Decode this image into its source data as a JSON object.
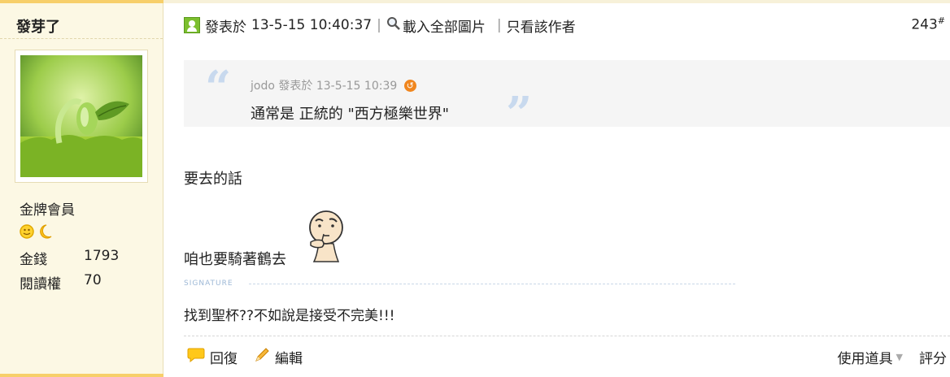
{
  "sidebar": {
    "username": "發芽了",
    "rank": "金牌會員",
    "stats": [
      {
        "label": "金錢",
        "value": "1793"
      },
      {
        "label": "閱讀權",
        "value": "70"
      }
    ]
  },
  "post": {
    "posted_label": "發表於",
    "timestamp": "13-5-15 10:40:37",
    "load_images": "載入全部圖片",
    "only_author": "只看該作者",
    "floor_number": "243",
    "floor_mark": "#"
  },
  "quote": {
    "author": "jodo",
    "posted_label": "發表於",
    "time": "13-5-15 10:39",
    "text": "通常是 正統的 \"西方極樂世界\""
  },
  "message": {
    "line1": "要去的話",
    "line2": "咱也要騎著鶴去"
  },
  "signature": {
    "label": "SIGNATURE",
    "text": "找到聖杯??不如說是接受不完美!!!"
  },
  "actions": {
    "reply": "回復",
    "edit": "編輯",
    "tools": "使用道具",
    "rate": "評分"
  },
  "colors": {
    "sidebar_bg": "#fcf8e4",
    "accent_bar": "#f7cf6a",
    "quote_bg": "#f5f5f5"
  }
}
